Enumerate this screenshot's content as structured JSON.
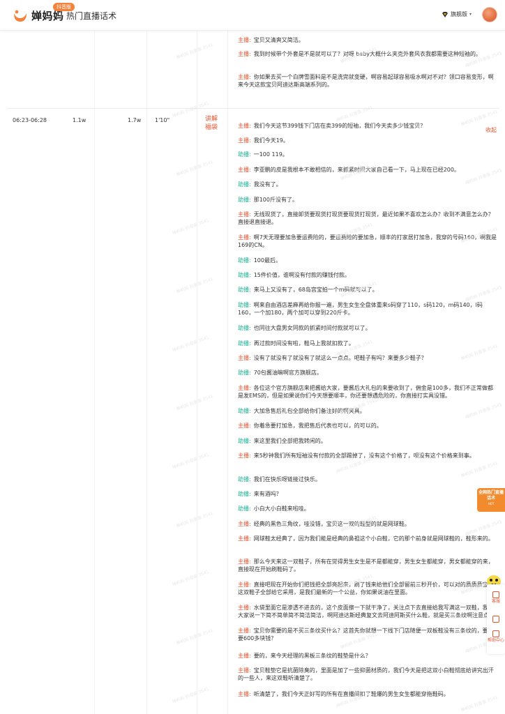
{
  "header": {
    "logo_text": "婵妈妈",
    "logo_badge": "抖音版",
    "page_name": "热门直播话术",
    "vip_label": "旗舰版",
    "icons": {
      "logo": "chanmama-logo-icon",
      "vip": "diamond-icon",
      "caret": "chevron-down-icon",
      "avatar": "user-avatar"
    }
  },
  "top_lines": [
    {
      "role": "主播:",
      "kind": "zhubo",
      "text": "宝贝又清爽又简洁。"
    },
    {
      "role": "主播:",
      "kind": "zhubo",
      "text": "我到时候带个外套是不是就可以了？对呀 baby大概什么夹克外套风衣我都需要这种短袖的。"
    },
    {
      "role": "主播:",
      "kind": "zhubo",
      "text": "你如果去买一个白牌雪面料是不是洗完就变硬，啊容易起球容易吸水啊对不对？领口容易变形，啊来今天这款宝贝阿迪达斯高端系列的。"
    }
  ],
  "collapse_label": "收起",
  "row": {
    "time": "06:23-06:28",
    "col2": "1.1w",
    "col3": "1.7w",
    "duration": "1'10\"",
    "tag": "讲解福袋"
  },
  "lines": [
    {
      "role": "主播:",
      "kind": "zhubo",
      "text": "我们今天这节399钱下门店在卖399的短袖，我们今天卖多少钱宝贝？"
    },
    {
      "role": "主播:",
      "kind": "zhubo",
      "text": "我们今天19。"
    },
    {
      "role": "助播:",
      "kind": "zhuli",
      "text": "一100 119。"
    },
    {
      "role": "主播:",
      "kind": "zhubo",
      "text": "李亚鹏的皮是我根本不敢相信的，来抓紧时间大家自己看一下，马上现在已经200。"
    },
    {
      "role": "助播:",
      "kind": "zhuli",
      "text": "我没有了。"
    },
    {
      "role": "助播:",
      "kind": "zhuli",
      "text": "那100斤没有了。"
    },
    {
      "role": "主播:",
      "kind": "zhubo",
      "text": "无线现货了，直接卸货要现货打现货要现货打现货，最近如果不喜欢怎么办？收到不满意怎么办？直接退直接退。"
    },
    {
      "role": "主播:",
      "kind": "zhubo",
      "text": "啊7天无理要加急要运费险的，要运费险的要加急，顺丰的打家居打加急，我穿的号码160，啊我是169的CN。"
    },
    {
      "role": "助播:",
      "kind": "zhuli",
      "text": "100最后。"
    },
    {
      "role": "助播:",
      "kind": "zhuli",
      "text": "15件价值，谁啊没有付款的赚钱付款。"
    },
    {
      "role": "助播:",
      "kind": "zhuli",
      "text": "来马上又没有了，68岛宫宝拍一个m码就可以了。"
    },
    {
      "role": "助播:",
      "kind": "zhuli",
      "text": "啊来自由酒店差麻再给你报一遍，男生女生全盘体重来s码穿了110，s码120，m码140，l码160，一个加180，两个加可以穿到220斤卡。"
    },
    {
      "role": "助播:",
      "kind": "zhuli",
      "text": "也同往大盘男女同款的抓紧时间付款就可以了。"
    },
    {
      "role": "助播:",
      "kind": "zhuli",
      "text": "再过款时间没有啦，鞋马上我就扣款了。"
    },
    {
      "role": "主播:",
      "kind": "zhubo",
      "text": "没有了就没有了就没有了就这么一点点。吧鞋子有吗？来要多少鞋子？"
    },
    {
      "role": "助播:",
      "kind": "zhuli",
      "text": "70包酱油嘛啊官方旗舰店。"
    },
    {
      "role": "主播:",
      "kind": "zhubo",
      "text": "各位这个官方旗舰店来把酱给大家，要酱后大礼包的来要收到了，佣金是100多，我们不正常做都是发EMS的，但是如果说你们今天想要顺丰，你还要想遇危险的，你直接打实具没错。"
    },
    {
      "role": "助播:",
      "kind": "zhuli",
      "text": "大加急售后礼包全部给你们备注好的啊夹具。"
    },
    {
      "role": "主播:",
      "kind": "zhubo",
      "text": "你着急要打加急，我把售后代表也可以，的可以的。"
    },
    {
      "role": "助播:",
      "kind": "zhuli",
      "text": "来这里我们全部把我转闲的。"
    },
    {
      "role": "主播:",
      "kind": "zhubo",
      "text": "来5秒钟我们所有短袖没有付款的全部踢掉了，没有这个价格了，呗没有这个价格来到事。"
    },
    {
      "role": "助播:",
      "kind": "zhuli",
      "text": "我们在快乐呀链接过快乐。"
    },
    {
      "role": "助播:",
      "kind": "zhuli",
      "text": "来有酒吗？"
    },
    {
      "role": "助播:",
      "kind": "zhuli",
      "text": "小白大小白鞋来啦哇。"
    },
    {
      "role": "主播:",
      "kind": "zhubo",
      "text": "经典的黑色三角纹，哇没错，宝贝这一双的鞋型的就是网球鞋。"
    },
    {
      "role": "主播:",
      "kind": "zhubo",
      "text": "网球鞋太经典了，因为我们能是经典的鼻祖这个小白鞋，它的那个前身就是网球鞋的，鞋形来的。"
    },
    {
      "role": "主播:",
      "kind": "zhubo",
      "text": "那么今天来这一双鞋子，所有在觉得男生女生是不是都能穿，男生女生都能穿，男女都能穿的来，直接现在开始刷鞋码了。"
    },
    {
      "role": "主播:",
      "kind": "zhubo",
      "text": "直接吧现在开始你们把钱把全部亮起来，刷了钱来给他们全部留前三秒开价，可以对的质质质宝贝这双鞋子全部给它采用，是我们最新的一个公益，你如果说油在里面。"
    },
    {
      "role": "主播:",
      "kind": "zhubo",
      "text": "水袋里面它是渗透不进去的，这个皮面擦一下就干净了，关注点下去直接给我写满这一双鞋，我跟大家说一下简不简单简不简洁简洁，啊阿迪达斯经典复文去阿迪阿斯买什么鞋，就是买三条纹啊注意点。"
    },
    {
      "role": "主播:",
      "kind": "zhubo",
      "text": "宝贝你需要的是不买三条纹买什么？这首先你就想一下线下门店随便一双板鞋没有三条纹的，要不要600多块钱？"
    },
    {
      "role": "主播:",
      "kind": "zhubo",
      "text": "要的，来今天经理的黑板三条纹的鞋垫是什么？"
    },
    {
      "role": "主播:",
      "kind": "zhubo",
      "text": "宝贝鞋垫它是抗菌除臭的，里面是加了一些抑菌材质的，我们今天是把这双小白鞋彻底给讲究出汗的一些人，来这双鞋听清楚了。"
    },
    {
      "role": "主播:",
      "kind": "zhubo",
      "text": "听清楚了，我们今天正好写的所有在直播间扣了鞋爆的男生女生都能穿拖鞋码。"
    }
  ],
  "widgets": {
    "promo_title": "全网热门直播话术",
    "promo_sub": "HOT",
    "sidebar": [
      {
        "label": "客服",
        "icon": "customer-service-icon"
      },
      {
        "label": "",
        "icon": "qrcode-icon"
      },
      {
        "label": "帮助中心",
        "icon": "help-center-icon"
      }
    ]
  },
  "watermark": "婵妈妈 抖音版 3541"
}
